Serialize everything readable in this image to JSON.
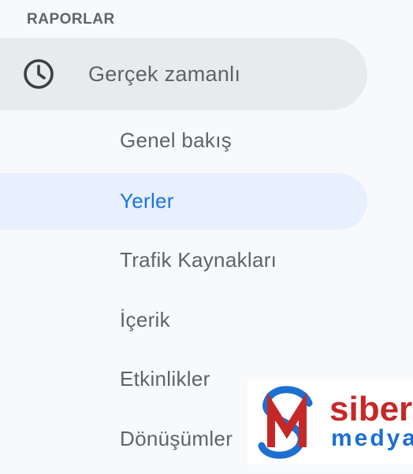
{
  "sidebar": {
    "section_title": "RAPORLAR",
    "parent_item": {
      "label": "Gerçek zamanlı",
      "icon": "clock-icon"
    },
    "items": [
      {
        "label": "Genel bakış",
        "active": false
      },
      {
        "label": "Yerler",
        "active": true
      },
      {
        "label": "Trafik Kaynakları",
        "active": false
      },
      {
        "label": "İçerik",
        "active": false
      },
      {
        "label": "Etkinlikler",
        "active": false
      },
      {
        "label": "Dönüşümler",
        "active": false
      }
    ]
  },
  "watermark": {
    "line1": "siber",
    "line2": "medya"
  },
  "colors": {
    "accent": "#1a73e8",
    "active_bg": "#e8f0fe",
    "parent_bg": "#e8eaed",
    "text": "#5f6368",
    "logo_red": "#c62828",
    "logo_blue": "#1d6fd1"
  }
}
